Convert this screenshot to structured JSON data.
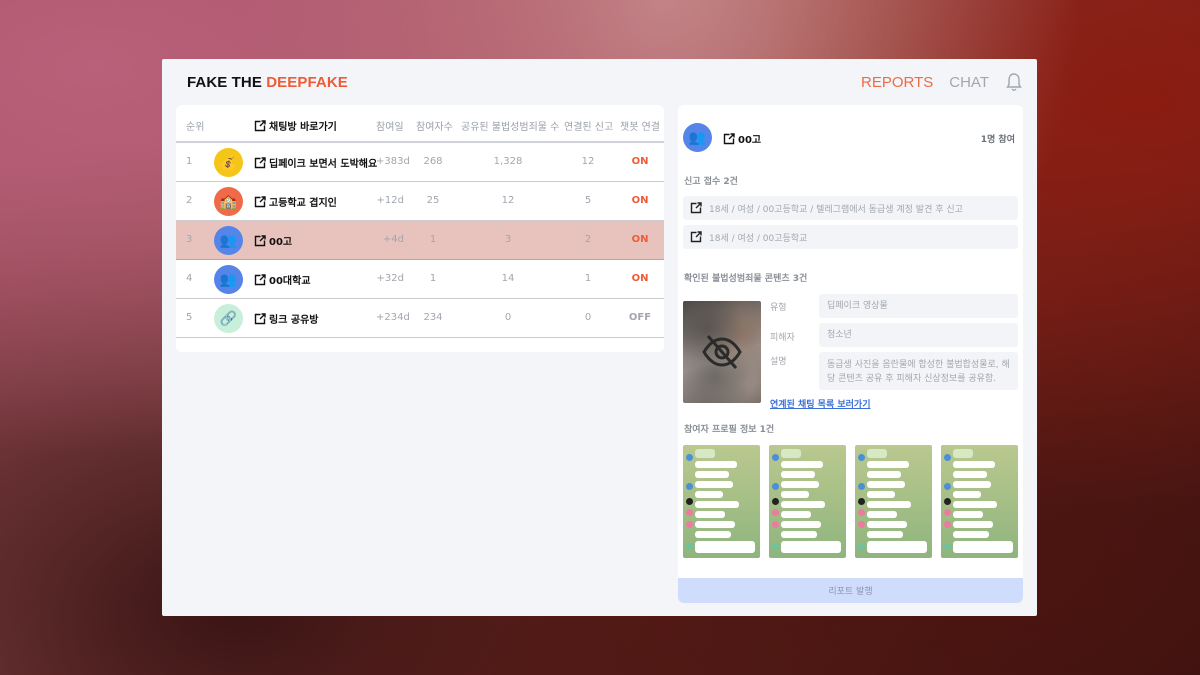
{
  "brand": {
    "prefix": "FAKE THE ",
    "accent": "DEEPFAKE"
  },
  "nav": {
    "reports": "REPORTS",
    "chat": "CHAT"
  },
  "table": {
    "headers": {
      "rank": "순위",
      "goto": "채팅방 바로가기",
      "days": "참여일",
      "people": "참여자수",
      "shared": "공유된 불법성범죄물 수",
      "reports": "연결된 신고",
      "bot": "챗봇 연결"
    },
    "rows": [
      {
        "rank": "1",
        "icon": "💰",
        "name": "딥페이크 보면서 도박해요",
        "days": "+383d",
        "people": "268",
        "shared": "1,328",
        "reports": "12",
        "bot": "ON"
      },
      {
        "rank": "2",
        "icon": "🏫",
        "name": "고등학교 겹지인",
        "days": "+12d",
        "people": "25",
        "shared": "12",
        "reports": "5",
        "bot": "ON"
      },
      {
        "rank": "3",
        "icon": "👥",
        "name": "00고",
        "days": "+4d",
        "people": "1",
        "shared": "3",
        "reports": "2",
        "bot": "ON"
      },
      {
        "rank": "4",
        "icon": "👥",
        "name": "00대학교",
        "days": "+32d",
        "people": "1",
        "shared": "14",
        "reports": "1",
        "bot": "ON"
      },
      {
        "rank": "5",
        "icon": "🔗",
        "name": "링크 공유방",
        "days": "+234d",
        "people": "234",
        "shared": "0",
        "reports": "0",
        "bot": "OFF"
      }
    ]
  },
  "detail": {
    "title": "00고",
    "participants": "1명 참여",
    "reports_label": "신고 접수 2건",
    "reports": [
      "18세 / 여성 / 00고등학교 / 텔레그램에서 동급생 계정 발견 후 신고",
      "18세 / 여성 / 00고등학교"
    ],
    "content_label": "확인된 불법성범죄물 콘텐츠 3건",
    "fields": {
      "type_label": "유형",
      "type_value": "딥페이크 영상물",
      "victim_label": "피해자",
      "victim_value": "청소년",
      "desc_label": "설명",
      "desc_value": "동급생 사진을 음란물에 합성한 불법합성물로, 해당 콘텐츠 공유 후 피해자 신상정보를 공유함."
    },
    "link": "연계된 채팅 목록 보러가기",
    "profiles_label": "참여자 프로필 정보 1건",
    "issue_button": "리포트 발행"
  },
  "colors": {
    "accent": "#ef5b35",
    "selected_row": "#e8c3bd",
    "link": "#3b6fd8",
    "button": "#cfdcfb"
  }
}
